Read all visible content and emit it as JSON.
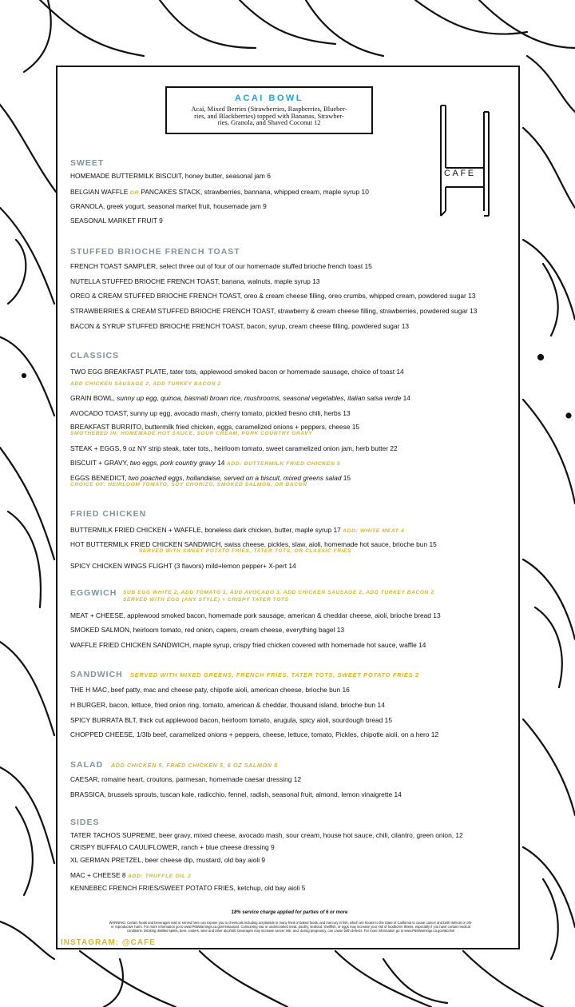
{
  "acai": {
    "title": "ACAI BOWL",
    "desc_1": "Acai, Mixed Berries (Strawberries, Raspberries, Blueber-",
    "desc_2": "ries, and Blackberries) topped with Bananas, Strawber-",
    "desc_3": "ries, Granola, and Shaved Coconut   12"
  },
  "logo": {
    "text": "CAFE"
  },
  "sweet": {
    "heading": "SWEET",
    "i1": "HOMEMADE BUTTERMILK BISCUIT,  honey butter, seasonal jam   6",
    "i2a": "BELGIAN WAFFLE ",
    "i2or": "OR",
    "i2b": "  PANCAKES STACK,  strawberries, bannana, whipped cream,  maple syrup    10",
    "i3": "GRANOLA,  greek yogurt, seasonal market fruit, housemade jam    9",
    "i4": "SEASONAL MARKET FRUIT   9"
  },
  "toast": {
    "heading": "STUFFED BRIOCHE FRENCH TOAST",
    "i1": "FRENCH TOAST SAMPLER, select three out of four of our homemade stuffed brioche french toast 15",
    "i2": "NUTELLA STUFFED BRIOCHE FRENCH TOAST,  banana,  walnuts, maple syrup   13",
    "i3": "OREO & CREAM STUFFED BRIOCHE FRENCH TOAST, oreo & cream cheese filling, oreo crumbs, whipped cream, powdered sugar 13",
    "i4": "STRAWBERRIES & CREAM STUFFED BRIOCHE FRENCH TOAST, strawberry & cream cheese filling, strawberries, powdered sugar 13",
    "i5": "BACON & SYRUP STUFFED BRIOCHE FRENCH TOAST, bacon, syrup, cream cheese filling, powdered sugar 13"
  },
  "classics": {
    "heading": "CLASSICS",
    "i1": "TWO EGG BREAKFAST PLATE,  tater tots, applewood smoked bacon or homemade sausage, choice of toast    14",
    "i1_add": "ADD CHICKEN SAUSAGE 2, ADD TURKEY BACON 2",
    "i2a": "GRAIN BOWL,   ",
    "i2b": " sunny up egg, quinoa, basmati brown rice, mushrooms, seasonal vegetables, italian salsa verde",
    "i2c": "   14",
    "i3": "AVOCADO TOAST,  sunny up egg, avocado mash, cherry tomato, pickled fresno chili, herbs   13",
    "i4": "BREAKFAST  BURRITO,  buttermilk fried chicken, eggs, caramelized onions + peppers, cheese  15",
    "i4_sub": "SMOTHERED IN: HOMEMADE HOT SAUCE, SOUR CREAM, PORK COUNTRY GRAVY",
    "i5": "STEAK + EGGS,   9 oz NY strip steak, tater tots,, heirloom tomato, sweet caramelized onion jam, herb butter    22",
    "i6a": "BISCUIT + GRAVY,  ",
    "i6b": "two eggs, pork country gravy",
    "i6c": "   14      ",
    "i6_add": "ADD: BUTTERMILK FRIED CHICKEN    5",
    "i7a": "EGGS BENEDICT,  ",
    "i7b": "two poached eggs, hollandaise, served on a biscuit, mixed greens salad",
    "i7c": "   15",
    "i7_sub": "CHOICE OF: HEIRLOOM TOMATO, SOY CHORIZO, SMOKED SALMON, OR BACON"
  },
  "fried": {
    "heading": "FRIED CHICKEN",
    "i1": "BUTTERMILK FRIED CHICKEN + WAFFLE,  boneless dark chicken, butter, maple syrup    17  ",
    "i1_add": "ADD: WHITE MEAT  4",
    "i2": "HOT BUTTERMILK FRIED CHICKEN SANDWICH,  swiss cheese, pickles, slaw, aioli, homemade hot sauce, brioche bun    15",
    "i2_sub": "SERVED WITH SWEET POTATO FRIES, TATER TOTS, OR CLASSIC FRIES",
    "i3": "SPICY CHICKEN WINGS FLIGHT (3 flavors) mild+lemon pepper+ X-pert 14"
  },
  "eggwich": {
    "heading": "EGGWICH",
    "add1": "SUB  EGG WHITE 2, ADD TOMATO 1, ADD AVOCADO 3, ADD CHICKEN SAUSAGE 2, ADD TURKEY BACON 2",
    "add2": "SERVED WITH EGG (ANY STYLE)  + CRISPY TATER TOTS",
    "i1": "MEAT + CHEESE,  applewood smoked bacon, homemade pork sausage, american & cheddar cheese, aioli, brioche bread    13",
    "i2": "SMOKED SALMON,  heirloom tomato, red onion, capers, cream cheese, everything bagel    13",
    "i3": "WAFFLE FRIED CHICKEN SANDWICH,  maple syrup, crispy fried chicken covered with homemade hot sauce, waffle    14"
  },
  "sandwich": {
    "heading": "SANDWICH",
    "add": "SERVED WITH MIXED GREENS, FRENCH FRIES, TATER TOTS, SWEET POTATO FRIES 2",
    "i1": "THE H MAC,  beef patty, mac and cheese paty, chipotle aioli, american cheese, brioche bun    16",
    "i2": "H BURGER,  bacon, lettuce, fried onion ring, tomato, american & cheddar, thousand island, brioche bun    14",
    "i3": "SPICY BURRATA BLT, thick cut applewood bacon, heirloom tomato, arugula, spicy aioli, sourdough bread    15",
    "i4": "CHOPPED CHEESE, 1/3lb beef, caramelized onions + peppers, cheese, lettuce, tomato, Pickles, chipotle aioli, on a hero    12"
  },
  "salad": {
    "heading": "SALAD",
    "add": "ADD CHICKEN  5, FRIED CHICKEN   5, 6 OZ SALMON 8",
    "i1": "CAESAR,  romaine heart, croutons, parmesan, homemade caesar dressing    12",
    "i2": "BRASSICA,  brussels sprouts, tuscan kale, radicchio, fennel, radish, seasonal fruit, almond, lemon vinaigrette    14"
  },
  "sides": {
    "heading": "SIDES",
    "i1": "TATER TACHOS SUPREME,  beer gravy, mixed cheese, avocado mash, sour cream, house hot sauce, chili, cilantro, green onion, 12",
    "i2": "CRISPY BUFFALO CAULIFLOWER,  ranch + blue cheese dressing    9",
    "i3": "XL GERMAN PRETZEL,  beer cheese dip, mustard, old bay aioli    9",
    "i4": "MAC + CHEESE   8     ",
    "i4_add": "ADD: TRUFFLE OIL 2",
    "i5": "KENNEBEC FRENCH FRIES/SWEET POTATO FRIES,  ketchup, old bay aioli   5"
  },
  "footer": {
    "service": "18% service charge applied for parties of 6 or more",
    "warning_1": "WARNING: Certain foods and beverages sold or served here can expose you to chemicals including acrylamide in many fried or baked foods, and mercury in fish, which are known to the State of California to cause cancer and birth defects or oth-",
    "warning_2": "er reproductive harm. For more information go to www.P65Warnings.ca.gov/restaurant. Consuming raw or undercooked meat, poultry, seafood, shellfish, or eggs may increase your risk of foodborne illness, especially if you have certain medical",
    "warning_3": "conditions. Drinking distilled spirits, beer, coolers, wine and other alcoholic beverages may increase cancer risk, and, during pregnancy, can cause birth defects.  For more information go to www.P65Warnings.ca.gov/alcohol",
    "instagram": "INSTAGRAM: @CAFE"
  }
}
